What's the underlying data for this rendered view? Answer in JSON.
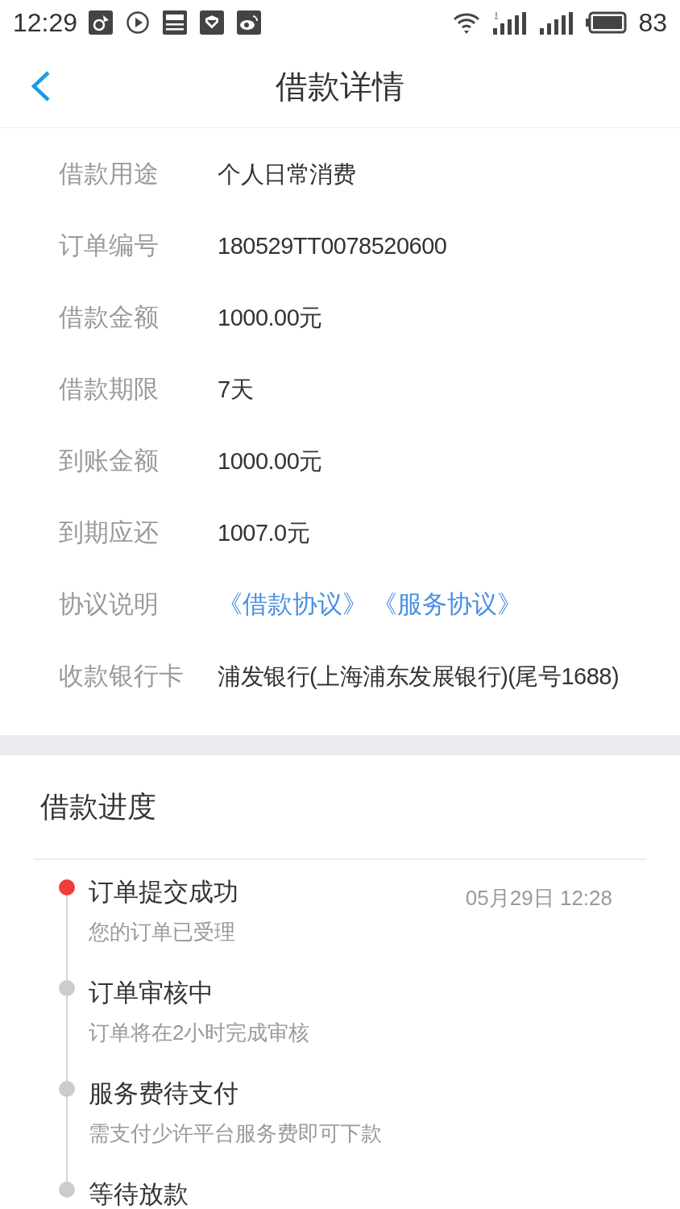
{
  "status_bar": {
    "time": "12:29",
    "battery": "83"
  },
  "header": {
    "title": "借款详情"
  },
  "details": [
    {
      "label": "借款用途",
      "value": "个人日常消费"
    },
    {
      "label": "订单编号",
      "value": "180529TT0078520600"
    },
    {
      "label": "借款金额",
      "value": "1000.00元"
    },
    {
      "label": "借款期限",
      "value": "7天"
    },
    {
      "label": "到账金额",
      "value": "1000.00元"
    },
    {
      "label": "到期应还",
      "value": "1007.0元"
    },
    {
      "label": "协议说明",
      "links": [
        "《借款协议》",
        "《服务协议》"
      ]
    },
    {
      "label": "收款银行卡",
      "value": "浦发银行(上海浦东发展银行)(尾号1688)"
    }
  ],
  "progress": {
    "title": "借款进度",
    "steps": [
      {
        "title": "订单提交成功",
        "subtitle": "您的订单已受理",
        "time": "05月29日 12:28",
        "current": true
      },
      {
        "title": "订单审核中",
        "subtitle": "订单将在2小时完成审核",
        "current": false
      },
      {
        "title": "服务费待支付",
        "subtitle": "需支付少许平台服务费即可下款",
        "current": false
      },
      {
        "title": "等待放款",
        "current": false
      }
    ]
  }
}
